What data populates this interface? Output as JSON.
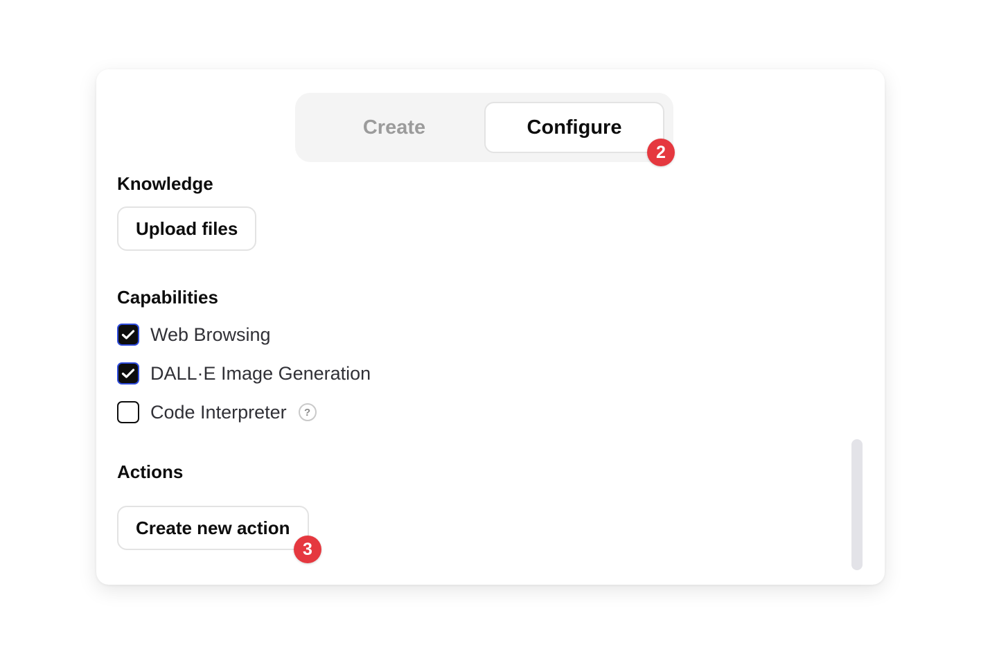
{
  "tabs": {
    "create_label": "Create",
    "configure_label": "Configure",
    "active": "Configure"
  },
  "badges": {
    "configure_step": "2",
    "action_step": "3"
  },
  "knowledge": {
    "title": "Knowledge",
    "upload_label": "Upload files"
  },
  "capabilities": {
    "title": "Capabilities",
    "items": [
      {
        "label": "Web Browsing",
        "checked": true
      },
      {
        "label": "DALL·E Image Generation",
        "checked": true
      },
      {
        "label": "Code Interpreter",
        "checked": false,
        "help_icon": "?"
      }
    ]
  },
  "actions": {
    "title": "Actions",
    "create_label": "Create new action"
  },
  "colors": {
    "badge": "#e5383f",
    "checkbox_checked_bg": "#0d0d0d",
    "checkbox_checked_border": "#2f4cdc",
    "segment_bg": "#f4f4f4",
    "inactive_tab_text": "#9b9b9b"
  }
}
